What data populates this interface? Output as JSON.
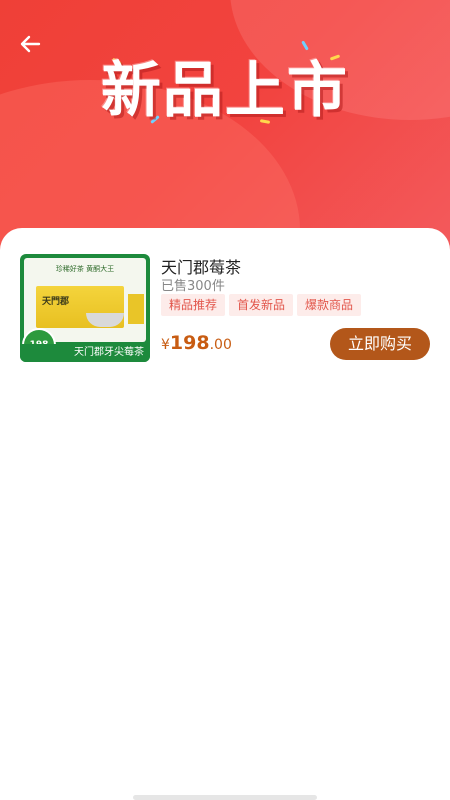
{
  "banner": {
    "title": "新品上市",
    "colors": {
      "background": "#ef4037",
      "accent": "#f35a5c"
    }
  },
  "nav": {
    "back_icon": "arrow-left-icon"
  },
  "product": {
    "name": "天门郡莓茶",
    "sold": "已售300件",
    "tags": [
      "精品推荐",
      "首发新品",
      "爆款商品"
    ],
    "price_symbol": "¥",
    "price_int": "198",
    "price_dec": ".00",
    "buy_label": "立即购买",
    "thumbnail": {
      "slogan": "珍稀好茶   黄酮大王",
      "box_label": "天門郡",
      "badge": "198",
      "strip": "天门郡牙尖莓茶"
    },
    "colors": {
      "price": "#c85c12",
      "button": "#b3571a",
      "tag_bg": "#fdecea",
      "tag_text": "#e2574c"
    }
  }
}
